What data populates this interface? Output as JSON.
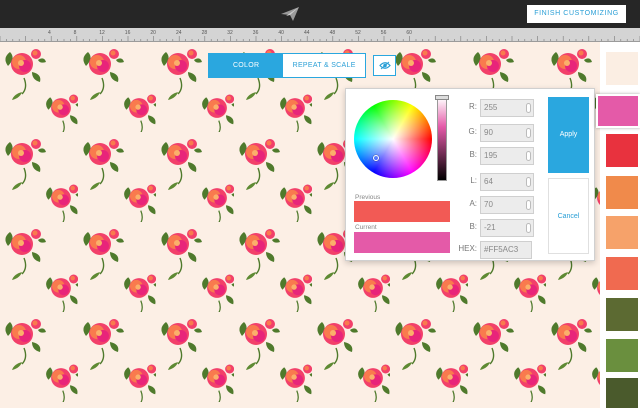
{
  "header": {
    "finish_label": "FINISH CUSTOMIZING"
  },
  "ruler": {
    "numbers": [
      "4",
      "8",
      "12",
      "16",
      "20",
      "24",
      "28",
      "32",
      "36",
      "40",
      "44",
      "48",
      "52",
      "56",
      "60"
    ]
  },
  "tabs": [
    {
      "label": "COLOR",
      "active": true
    },
    {
      "label": "REPEAT & SCALE",
      "active": false
    }
  ],
  "picker": {
    "previous_label": "Previous",
    "current_label": "Current",
    "previous_color": "#f25a55",
    "current_color": "#e45aa8",
    "fields": {
      "r": {
        "label": "R:",
        "value": "255"
      },
      "g": {
        "label": "G:",
        "value": "90"
      },
      "b": {
        "label": "B:",
        "value": "195"
      },
      "l": {
        "label": "L:",
        "value": "64"
      },
      "a": {
        "label": "A:",
        "value": "70"
      },
      "b2": {
        "label": "B:",
        "value": "-21"
      }
    },
    "hex": {
      "label": "HEX:",
      "value": "#FF5AC3"
    },
    "apply_label": "Apply",
    "cancel_label": "Cancel"
  },
  "palette": [
    "#fbeee3",
    "#e45aa8",
    "#e8323e",
    "#f08a4b",
    "#f6a26a",
    "#f06a50",
    "#5c6a32",
    "#6a8f3e",
    "#4a5a2c"
  ],
  "colors": {
    "accent": "#2aa7df",
    "topbar": "#262626",
    "background": "#fbeee3"
  }
}
